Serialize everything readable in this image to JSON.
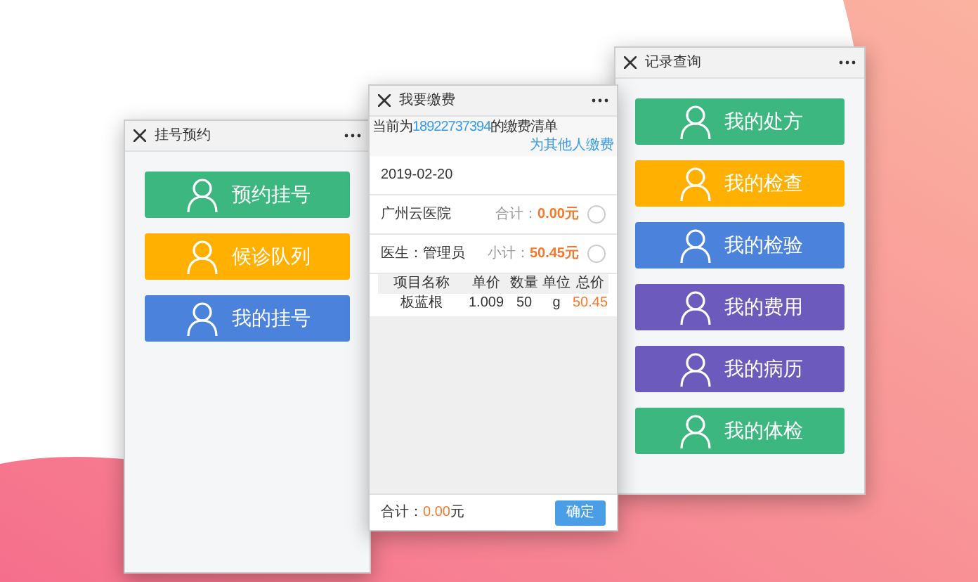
{
  "screens": [
    {
      "kind": "menu",
      "title": "挂号预约",
      "buttons": [
        {
          "label": "预约挂号",
          "color": "#3cb77f"
        },
        {
          "label": "候诊队列",
          "color": "#ffb000"
        },
        {
          "label": "我的挂号",
          "color": "#4a82dc"
        }
      ]
    },
    {
      "kind": "payment",
      "title": "我要缴费",
      "notice": {
        "before": "当前为",
        "number": "18922737394",
        "after": "的缴费清单"
      },
      "link": "为其他人缴费",
      "date": "2019-02-20",
      "groups": [
        {
          "name": "广州云医院",
          "sum_label": "合计：",
          "sum": "0.00元",
          "checked": false
        },
        {
          "name": "医生：管理员",
          "sum_label": "小计：",
          "sum": "50.45元",
          "checked": false
        }
      ],
      "table": {
        "columns": [
          "项目名称",
          "单价",
          "数量",
          "单位",
          "总价"
        ],
        "rows": [
          [
            "板蓝根",
            "1.009",
            "50",
            "g",
            "50.45"
          ]
        ]
      },
      "footer": {
        "label": "合计：",
        "amount": "0.00",
        "unit": "元",
        "button": "确定"
      }
    },
    {
      "kind": "menu",
      "title": "记录查询",
      "buttons": [
        {
          "label": "我的处方",
          "color": "#3cb77f"
        },
        {
          "label": "我的检查",
          "color": "#ffb000"
        },
        {
          "label": "我的检验",
          "color": "#4a82dc"
        },
        {
          "label": "我的费用",
          "color": "#6c5bbd"
        },
        {
          "label": "我的病历",
          "color": "#6c5bbd"
        },
        {
          "label": "我的体检",
          "color": "#3cb77f"
        }
      ]
    }
  ]
}
